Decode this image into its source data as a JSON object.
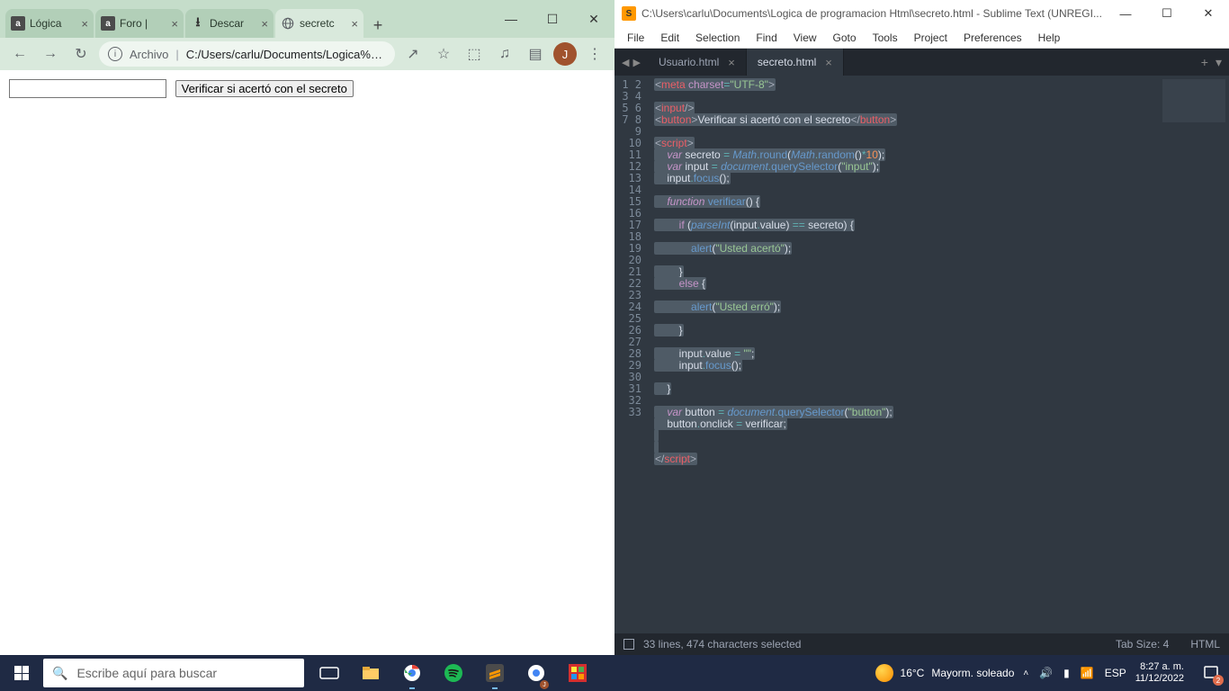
{
  "chrome": {
    "tabs": [
      {
        "title": "Lógica",
        "favicon": "a"
      },
      {
        "title": "Foro |",
        "favicon": "a"
      },
      {
        "title": "Descar",
        "favicon": "dl"
      },
      {
        "title": "secretc",
        "favicon": "globe"
      }
    ],
    "active_tab": 3,
    "newtab": "+",
    "winbtns": {
      "min": "—",
      "max": "☐",
      "close": "✕"
    },
    "nav": {
      "back": "←",
      "fwd": "→",
      "reload": "↻"
    },
    "omnibox": {
      "archivo_label": "Archivo",
      "separator": "|",
      "url": "C:/Users/carlu/Documents/Logica%20de..."
    },
    "toolbar_icons": {
      "share": "↗",
      "star": "☆",
      "ext": "⬚",
      "music": "♫",
      "panel": "▤"
    },
    "avatar": "J",
    "menu": "⋮",
    "page": {
      "button_label": "Verificar si acertó con el secreto"
    }
  },
  "sublime": {
    "title": "C:\\Users\\carlu\\Documents\\Logica de programacion Html\\secreto.html - Sublime Text (UNREGI...",
    "winbtns": {
      "min": "—",
      "max": "☐",
      "close": "✕"
    },
    "menu": [
      "File",
      "Edit",
      "Selection",
      "Find",
      "View",
      "Goto",
      "Tools",
      "Project",
      "Preferences",
      "Help"
    ],
    "nav_arrows": {
      "left": "◀",
      "right": "▶"
    },
    "tabs": [
      {
        "name": "Usuario.html"
      },
      {
        "name": "secreto.html"
      }
    ],
    "active_tab": 1,
    "tabbar_right": {
      "plus": "+",
      "menu": "▾"
    },
    "status": {
      "left": "33 lines, 474 characters selected",
      "tabsize": "Tab Size: 4",
      "lang": "HTML"
    },
    "line_count": 33
  },
  "taskbar": {
    "search_placeholder": "Escribe aquí para buscar",
    "weather": {
      "temp": "16°C",
      "desc": "Mayorm. soleado"
    },
    "tray": {
      "chevron": "˄",
      "speaker": "🔊",
      "battery": "▮",
      "wifi": "📶",
      "lang": "ESP"
    },
    "clock": {
      "time": "8:27 a. m.",
      "date": "11/12/2022"
    },
    "notif_count": "2"
  }
}
